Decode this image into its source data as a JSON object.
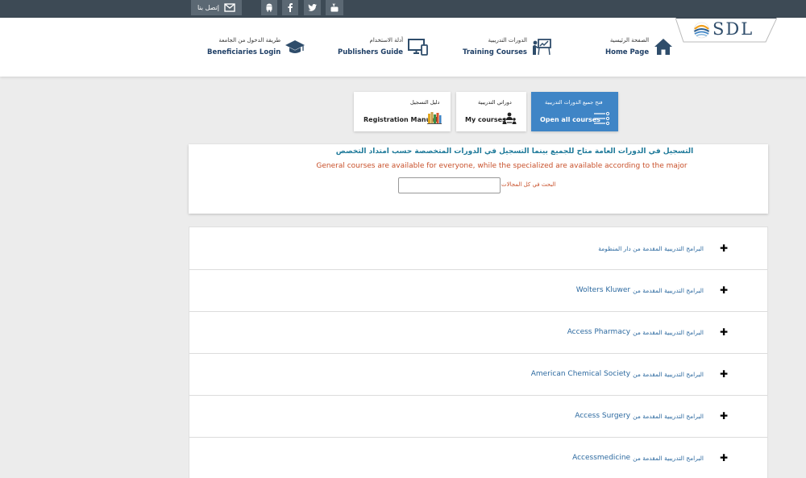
{
  "topbar": {
    "contact_label": "إتصل بنا",
    "icons": [
      "mail-icon",
      "android-icon",
      "facebook-icon",
      "twitter-icon",
      "youtube-icon"
    ]
  },
  "logo": {
    "text": "SDL"
  },
  "nav": {
    "home": {
      "ar": "الصفحة الرئيسية",
      "en": "Home Page"
    },
    "training": {
      "ar": "الدورات التدريبية",
      "en": "Training Courses"
    },
    "publishers": {
      "ar": "أدلة الاستخدام",
      "en": "Publishers Guide"
    },
    "beneficiaries": {
      "ar": "طريقة الدخول من الجامعة",
      "en": "Beneficiaries Login"
    }
  },
  "cards": {
    "open_all": {
      "ar": "فتح جميع الدورات التدريبية",
      "en": "Open all courses"
    },
    "my_courses": {
      "ar": "دوراتي التدريبية",
      "en": "My courses"
    },
    "manual": {
      "ar": "دليل التسجيل",
      "en": "Registration Manual"
    }
  },
  "info": {
    "ar": "التسجيل في الدورات العامة متاح للجميع بينما التسجيل في الدورات المتخصصة حسب امتداد التخصص",
    "en": "General courses are available for everyone, while the specialized are available according to the major",
    "search_label": "البحث في كل المجالات",
    "search_value": ""
  },
  "accordion": [
    {
      "ar": "البرامج التدريبية المقدمة من دار المنظومة",
      "en": ""
    },
    {
      "ar": "البرامج التدريبية المقدمة من",
      "en": "Wolters Kluwer"
    },
    {
      "ar": "البرامج التدريبية المقدمة من",
      "en": "Access Pharmacy"
    },
    {
      "ar": "البرامج التدريبية المقدمة من",
      "en": "American Chemical Society"
    },
    {
      "ar": "البرامج التدريبية المقدمة من",
      "en": "Access Surgery"
    },
    {
      "ar": "البرامج التدريبية المقدمة من",
      "en": "Accessmedicine"
    }
  ],
  "colors": {
    "topbar": "#3d4a55",
    "accent_blue": "#3f85c6",
    "link_blue": "#2d6aa0",
    "notice_orange": "#c8502a",
    "notice_teal": "#1f7a9a"
  }
}
